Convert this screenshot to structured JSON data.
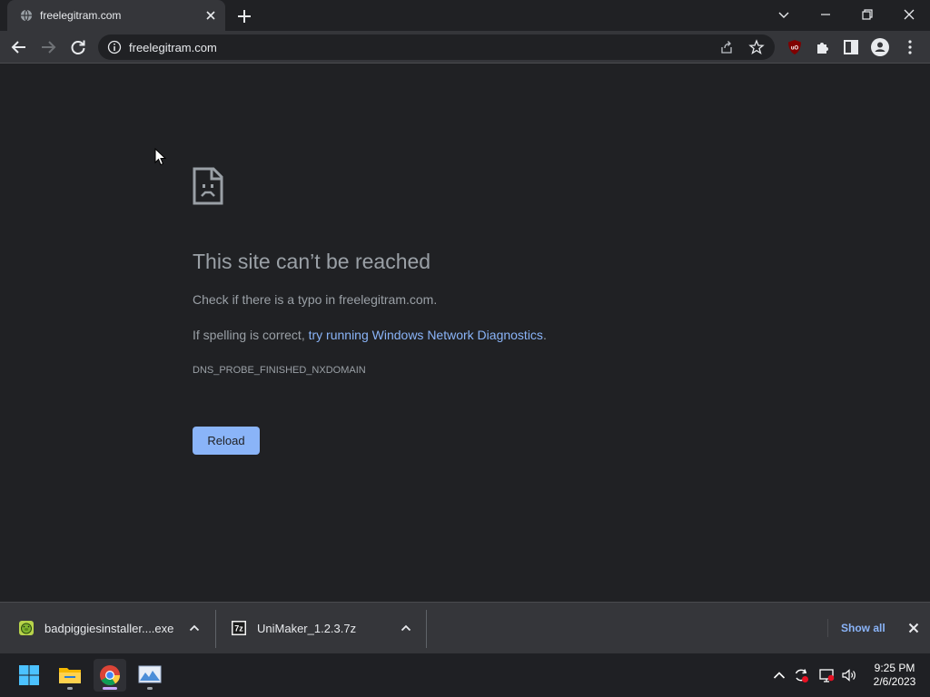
{
  "browser": {
    "tab": {
      "title": "freelegitram.com",
      "favicon": "globe-icon"
    },
    "toolbar": {
      "url": "freelegitram.com"
    }
  },
  "error_page": {
    "title": "This site can’t be reached",
    "line1": "Check if there is a typo in freelegitram.com.",
    "line2_prefix": "If spelling is correct, ",
    "line2_link": "try running Windows Network Diagnostics",
    "line2_suffix": ".",
    "code": "DNS_PROBE_FINISHED_NXDOMAIN",
    "reload_label": "Reload"
  },
  "downloads": {
    "items": [
      {
        "name": "badpiggiesinstaller....exe",
        "icon": "pig-app-icon"
      },
      {
        "name": "UniMaker_1.2.3.7z",
        "icon": "7zip-archive-icon"
      }
    ],
    "show_all_label": "Show all"
  },
  "taskbar": {
    "apps": [
      "windows-start-icon",
      "file-explorer-icon",
      "chrome-icon",
      "photos-icon"
    ],
    "clock": {
      "time": "9:25 PM",
      "date": "2/6/2023"
    }
  },
  "colors": {
    "background": "#202124",
    "toolbar": "#35363a",
    "accent_blue": "#8ab4f8",
    "text_secondary": "#9aa0a6"
  }
}
